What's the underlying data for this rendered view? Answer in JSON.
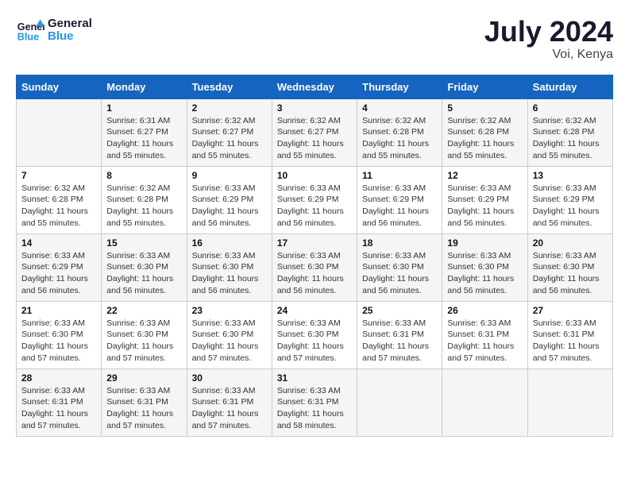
{
  "header": {
    "logo_general": "General",
    "logo_blue": "Blue",
    "month_year": "July 2024",
    "location": "Voi, Kenya"
  },
  "weekdays": [
    "Sunday",
    "Monday",
    "Tuesday",
    "Wednesday",
    "Thursday",
    "Friday",
    "Saturday"
  ],
  "weeks": [
    [
      {
        "day": "",
        "info": ""
      },
      {
        "day": "1",
        "info": "Sunrise: 6:31 AM\nSunset: 6:27 PM\nDaylight: 11 hours\nand 55 minutes."
      },
      {
        "day": "2",
        "info": "Sunrise: 6:32 AM\nSunset: 6:27 PM\nDaylight: 11 hours\nand 55 minutes."
      },
      {
        "day": "3",
        "info": "Sunrise: 6:32 AM\nSunset: 6:27 PM\nDaylight: 11 hours\nand 55 minutes."
      },
      {
        "day": "4",
        "info": "Sunrise: 6:32 AM\nSunset: 6:28 PM\nDaylight: 11 hours\nand 55 minutes."
      },
      {
        "day": "5",
        "info": "Sunrise: 6:32 AM\nSunset: 6:28 PM\nDaylight: 11 hours\nand 55 minutes."
      },
      {
        "day": "6",
        "info": "Sunrise: 6:32 AM\nSunset: 6:28 PM\nDaylight: 11 hours\nand 55 minutes."
      }
    ],
    [
      {
        "day": "7",
        "info": "Sunrise: 6:32 AM\nSunset: 6:28 PM\nDaylight: 11 hours\nand 55 minutes."
      },
      {
        "day": "8",
        "info": "Sunrise: 6:32 AM\nSunset: 6:28 PM\nDaylight: 11 hours\nand 55 minutes."
      },
      {
        "day": "9",
        "info": "Sunrise: 6:33 AM\nSunset: 6:29 PM\nDaylight: 11 hours\nand 56 minutes."
      },
      {
        "day": "10",
        "info": "Sunrise: 6:33 AM\nSunset: 6:29 PM\nDaylight: 11 hours\nand 56 minutes."
      },
      {
        "day": "11",
        "info": "Sunrise: 6:33 AM\nSunset: 6:29 PM\nDaylight: 11 hours\nand 56 minutes."
      },
      {
        "day": "12",
        "info": "Sunrise: 6:33 AM\nSunset: 6:29 PM\nDaylight: 11 hours\nand 56 minutes."
      },
      {
        "day": "13",
        "info": "Sunrise: 6:33 AM\nSunset: 6:29 PM\nDaylight: 11 hours\nand 56 minutes."
      }
    ],
    [
      {
        "day": "14",
        "info": "Sunrise: 6:33 AM\nSunset: 6:29 PM\nDaylight: 11 hours\nand 56 minutes."
      },
      {
        "day": "15",
        "info": "Sunrise: 6:33 AM\nSunset: 6:30 PM\nDaylight: 11 hours\nand 56 minutes."
      },
      {
        "day": "16",
        "info": "Sunrise: 6:33 AM\nSunset: 6:30 PM\nDaylight: 11 hours\nand 56 minutes."
      },
      {
        "day": "17",
        "info": "Sunrise: 6:33 AM\nSunset: 6:30 PM\nDaylight: 11 hours\nand 56 minutes."
      },
      {
        "day": "18",
        "info": "Sunrise: 6:33 AM\nSunset: 6:30 PM\nDaylight: 11 hours\nand 56 minutes."
      },
      {
        "day": "19",
        "info": "Sunrise: 6:33 AM\nSunset: 6:30 PM\nDaylight: 11 hours\nand 56 minutes."
      },
      {
        "day": "20",
        "info": "Sunrise: 6:33 AM\nSunset: 6:30 PM\nDaylight: 11 hours\nand 56 minutes."
      }
    ],
    [
      {
        "day": "21",
        "info": "Sunrise: 6:33 AM\nSunset: 6:30 PM\nDaylight: 11 hours\nand 57 minutes."
      },
      {
        "day": "22",
        "info": "Sunrise: 6:33 AM\nSunset: 6:30 PM\nDaylight: 11 hours\nand 57 minutes."
      },
      {
        "day": "23",
        "info": "Sunrise: 6:33 AM\nSunset: 6:30 PM\nDaylight: 11 hours\nand 57 minutes."
      },
      {
        "day": "24",
        "info": "Sunrise: 6:33 AM\nSunset: 6:30 PM\nDaylight: 11 hours\nand 57 minutes."
      },
      {
        "day": "25",
        "info": "Sunrise: 6:33 AM\nSunset: 6:31 PM\nDaylight: 11 hours\nand 57 minutes."
      },
      {
        "day": "26",
        "info": "Sunrise: 6:33 AM\nSunset: 6:31 PM\nDaylight: 11 hours\nand 57 minutes."
      },
      {
        "day": "27",
        "info": "Sunrise: 6:33 AM\nSunset: 6:31 PM\nDaylight: 11 hours\nand 57 minutes."
      }
    ],
    [
      {
        "day": "28",
        "info": "Sunrise: 6:33 AM\nSunset: 6:31 PM\nDaylight: 11 hours\nand 57 minutes."
      },
      {
        "day": "29",
        "info": "Sunrise: 6:33 AM\nSunset: 6:31 PM\nDaylight: 11 hours\nand 57 minutes."
      },
      {
        "day": "30",
        "info": "Sunrise: 6:33 AM\nSunset: 6:31 PM\nDaylight: 11 hours\nand 57 minutes."
      },
      {
        "day": "31",
        "info": "Sunrise: 6:33 AM\nSunset: 6:31 PM\nDaylight: 11 hours\nand 58 minutes."
      },
      {
        "day": "",
        "info": ""
      },
      {
        "day": "",
        "info": ""
      },
      {
        "day": "",
        "info": ""
      }
    ]
  ]
}
